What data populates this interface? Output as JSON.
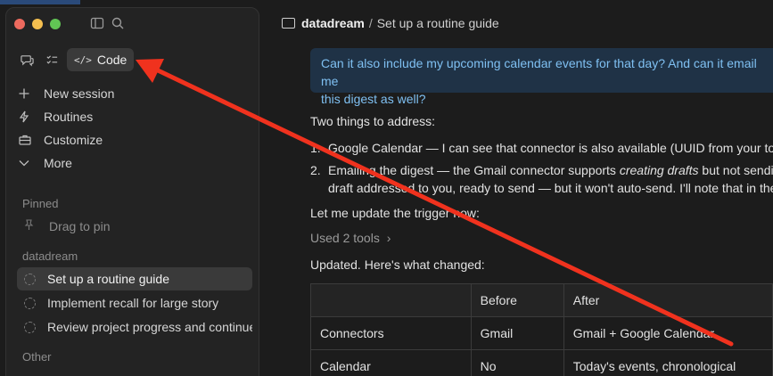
{
  "window": {
    "title": "datadream / Set up a routine guide"
  },
  "toolbar": {
    "sidebar_icon": "sidebar-toggle-icon",
    "search_icon": "search-icon"
  },
  "modes": {
    "chat_icon": "chat-icon",
    "tasks_icon": "tasks-icon",
    "code_label": "Code"
  },
  "nav": [
    {
      "label": "New session",
      "icon": "plus-icon"
    },
    {
      "label": "Routines",
      "icon": "bolt-icon"
    },
    {
      "label": "Customize",
      "icon": "briefcase-icon"
    },
    {
      "label": "More",
      "icon": "chevron-down-icon"
    }
  ],
  "pinned": {
    "heading": "Pinned",
    "drag_label": "Drag to pin"
  },
  "project": {
    "heading": "datadream",
    "sessions": [
      "Set up a routine guide",
      "Implement recall for large story",
      "Review project progress and continue"
    ]
  },
  "other": {
    "heading": "Other"
  },
  "breadcrumb": {
    "project": "datadream",
    "separator": "/",
    "page": "Set up a routine guide"
  },
  "conversation": {
    "user_line1": "Can it also include my upcoming calendar events for that day? And can it email me",
    "user_line2": "this digest as well?",
    "intro": "Two things to address:",
    "item1_num": "1.",
    "item1": "Google Calendar — I can see that connector is also available (UUID from your tools",
    "item2_num": "2.",
    "item2_a": "Emailing the digest — the Gmail connector supports ",
    "item2_em": "creating drafts",
    "item2_b": " but not sendin",
    "item2_line2": "draft addressed to you, ready to send — but it won't auto-send. I'll note that in the",
    "update_line": "Let me update the trigger now:",
    "tools_used": "Used 2 tools",
    "tools_chevron": "›",
    "updated_line": "Updated. Here's what changed:"
  },
  "table": {
    "headers": [
      "",
      "Before",
      "After"
    ],
    "rows": [
      [
        "Connectors",
        "Gmail",
        "Gmail + Google Calendar"
      ],
      [
        "Calendar",
        "No",
        "Today's events, chronological"
      ]
    ]
  },
  "colors": {
    "arrow": "#f0321e",
    "user_bubble": "#1f3246",
    "user_text": "#7fc0f2"
  }
}
